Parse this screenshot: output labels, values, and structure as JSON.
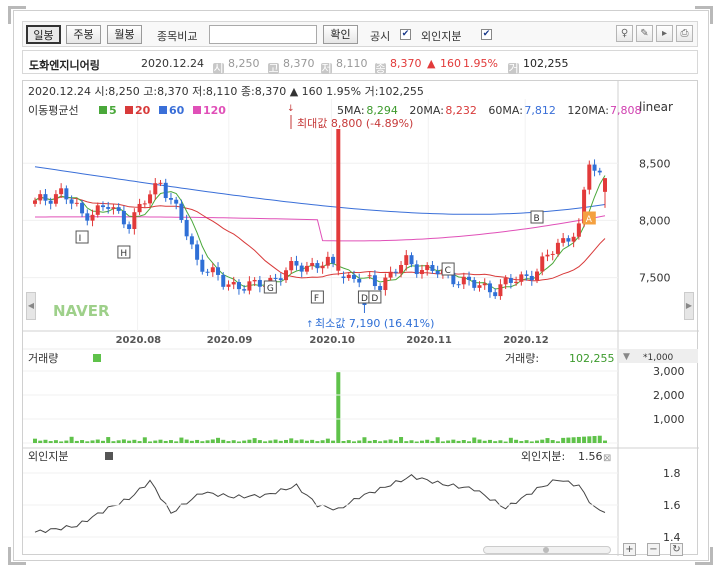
{
  "toolbar": {
    "period_tabs": [
      "일봉",
      "주봉",
      "월봉"
    ],
    "compare_label": "종목비교",
    "compare_input_value": "",
    "confirm_button": "확인",
    "disclosure_label": "공시",
    "foreign_label": "외인지분",
    "disclosure_checked": true,
    "foreign_checked": true
  },
  "info": {
    "stock_name": "도화엔지니어링",
    "date": "2020.12.24",
    "open_icon": "시",
    "open": "8,250",
    "high_icon": "고",
    "high": "8,370",
    "low_icon": "저",
    "low": "8,110",
    "close_icon": "종",
    "close": "8,370",
    "change_arrow": "▲",
    "change": "160",
    "change_pct": "1.95%",
    "volume_icon": "거",
    "volume": "102,255"
  },
  "price_panel": {
    "ohlc_line": "2020.12.24  시:8,250  고:8,370  저:8,110  종:8,370  ▲    160   1.95%  거:102,255",
    "ma_title": "이동평균선",
    "ma_legend": [
      {
        "label": "5",
        "color": "#4aa83a"
      },
      {
        "label": "20",
        "color": "#d83a3a"
      },
      {
        "label": "60",
        "color": "#3a6fd8"
      },
      {
        "label": "120",
        "color": "#e050b8"
      }
    ],
    "ma_values": [
      {
        "label": "5MA:",
        "value": "8,294",
        "color": "#3c9a2c"
      },
      {
        "label": "20MA:",
        "value": "8,232",
        "color": "#d83a3a"
      },
      {
        "label": "60MA:",
        "value": "7,812",
        "color": "#3a6fd8"
      },
      {
        "label": "120MA:",
        "value": "7,808",
        "color": "#d040b0"
      }
    ],
    "scale_mode": "linear",
    "max_label": "최대값 8,800 (-4.89%)",
    "min_label": "최소값 7,190 (16.41%)",
    "watermark": "NAVER",
    "y_ticks": [
      "8,500",
      "8,000",
      "7,500"
    ],
    "x_ticks": [
      "2020.08",
      "2020.09",
      "2020.10",
      "2020.11",
      "2020.12"
    ],
    "event_markers": [
      "I",
      "H",
      "G",
      "F",
      "D",
      "D",
      "C",
      "B",
      "A"
    ]
  },
  "volume_panel": {
    "title": "거래량",
    "value_label": "거래량:",
    "value": "102,255",
    "unit": "*1,000",
    "y_ticks": [
      "3,000",
      "2,000",
      "1,000"
    ]
  },
  "foreign_panel": {
    "title": "외인지분",
    "value_label": "외인지분:",
    "value": "1.56",
    "y_ticks": [
      "1.8",
      "1.6",
      "1.4"
    ]
  },
  "colors": {
    "up": "#e23a3a",
    "down": "#2f6fd6",
    "volume": "#5fc24a",
    "accent_orange": "#f4a040"
  },
  "chart_data": {
    "type": "candlestick",
    "x_range": [
      "2020.07.17",
      "2020.12.24"
    ],
    "y_range": [
      7190,
      8800
    ],
    "series": [
      {
        "name": "5",
        "values_estimated_end": 8294
      },
      {
        "name": "20",
        "values_estimated_end": 8232
      },
      {
        "name": "60",
        "values_estimated_end": 7812
      },
      {
        "name": "120",
        "values_estimated_end": 7808
      }
    ],
    "last_candle": {
      "date": "2020.12.24",
      "open": 8250,
      "high": 8370,
      "low": 8110,
      "close": 8370
    },
    "max": {
      "value": 8800
    },
    "min": {
      "value": 7190
    },
    "foreign_ownership_last": 1.56,
    "volume_last": 102255
  }
}
